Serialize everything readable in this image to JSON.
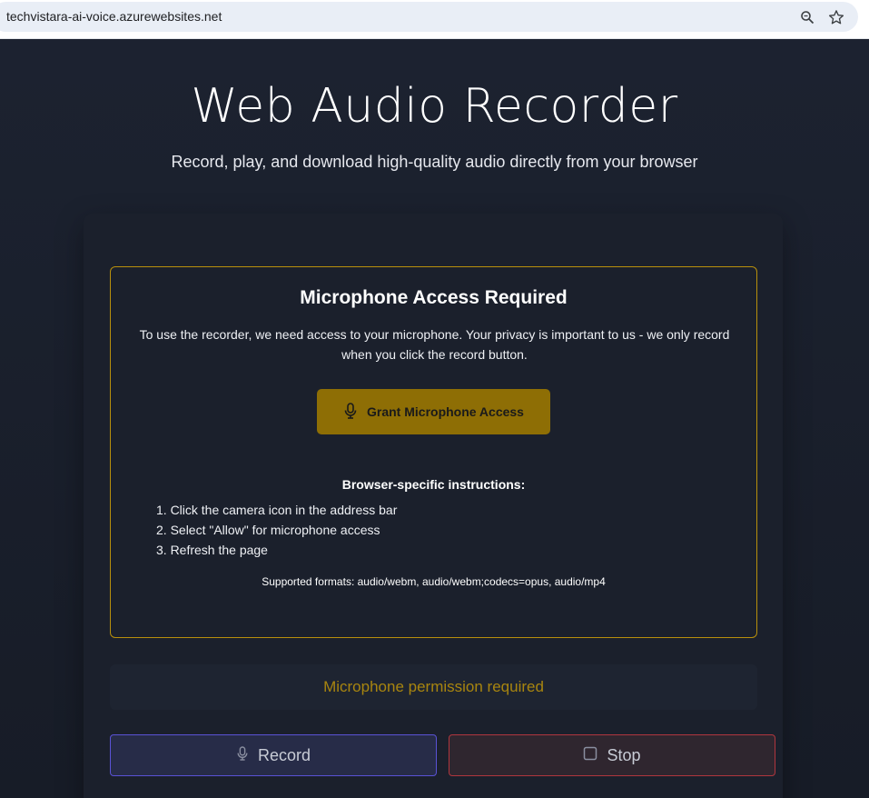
{
  "browser": {
    "url": "techvistara-ai-voice.azurewebsites.net",
    "icons": [
      "zoom-icon",
      "star-icon"
    ]
  },
  "header": {
    "title": "Web Audio Recorder",
    "subtitle": "Record, play, and download high-quality audio directly from your browser"
  },
  "permission": {
    "title": "Microphone Access Required",
    "text": "To use the recorder, we need access to your microphone. Your privacy is important to us - we only record when you click the record button.",
    "grant_label": "Grant Microphone Access",
    "instructions_title": "Browser-specific instructions:",
    "instructions": [
      "1. Click the camera icon in the address bar",
      "2. Select \"Allow\" for microphone access",
      "3. Refresh the page"
    ],
    "formats": "Supported formats: audio/webm, audio/webm;codecs=opus, audio/mp4"
  },
  "status": {
    "text": "Microphone permission required"
  },
  "controls": {
    "record_label": "Record",
    "stop_label": "Stop"
  },
  "colors": {
    "accent_gold": "#b8900c",
    "grant_button": "#8e6e05",
    "record_border": "#5a52d6",
    "stop_border": "#b0363e"
  }
}
